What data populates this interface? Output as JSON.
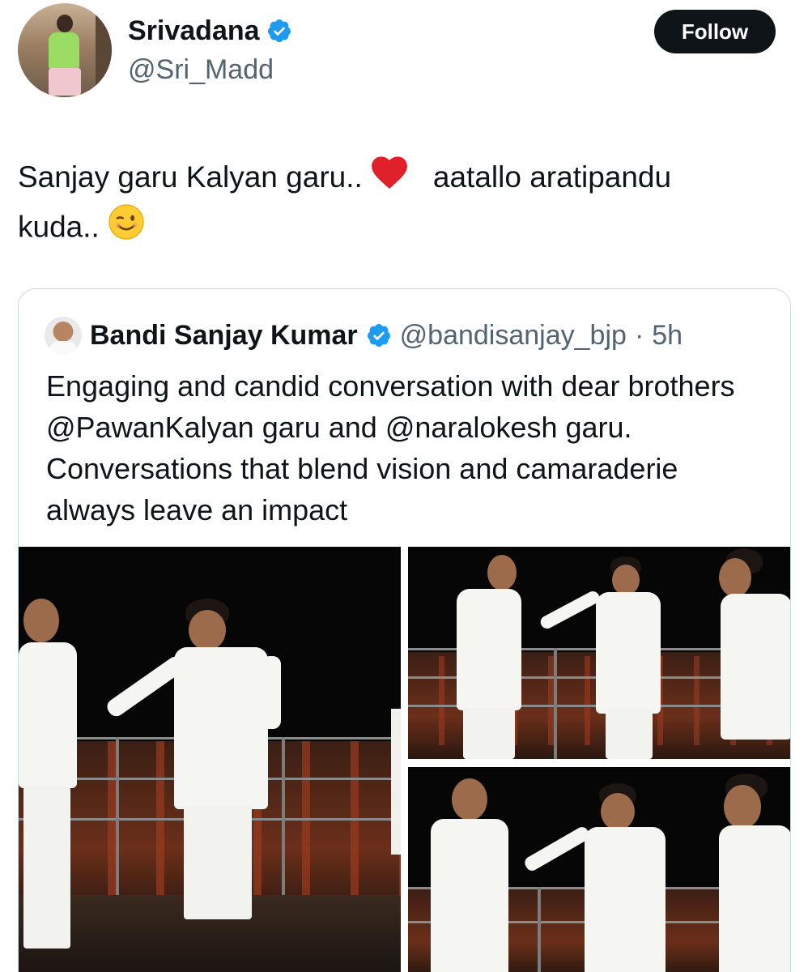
{
  "author": {
    "display_name": "Srivadana",
    "handle": "@Sri_Madd",
    "verified": true,
    "follow_label": "Follow"
  },
  "tweet": {
    "text_part1": "Sanjay garu Kalyan garu..",
    "emoji1": "❤️",
    "text_part2": "aatallo aratipandu",
    "text_part3": "kuda..",
    "emoji2": "😉"
  },
  "quoted_tweet": {
    "display_name": "Bandi Sanjay Kumar",
    "handle": "@bandisanjay_bjp",
    "separator": "·",
    "time": "5h",
    "verified": true,
    "text": "Engaging and candid conversation with dear brothers @PawanKalyan garu and @naralokesh garu. Conversations that blend vision and camaraderie always leave an impact",
    "media_count": 3
  },
  "colors": {
    "accent": "#1d9bf0",
    "text_primary": "#0f1419",
    "text_secondary": "#536471",
    "button_bg": "#0f1419",
    "border": "#cfd9de"
  }
}
